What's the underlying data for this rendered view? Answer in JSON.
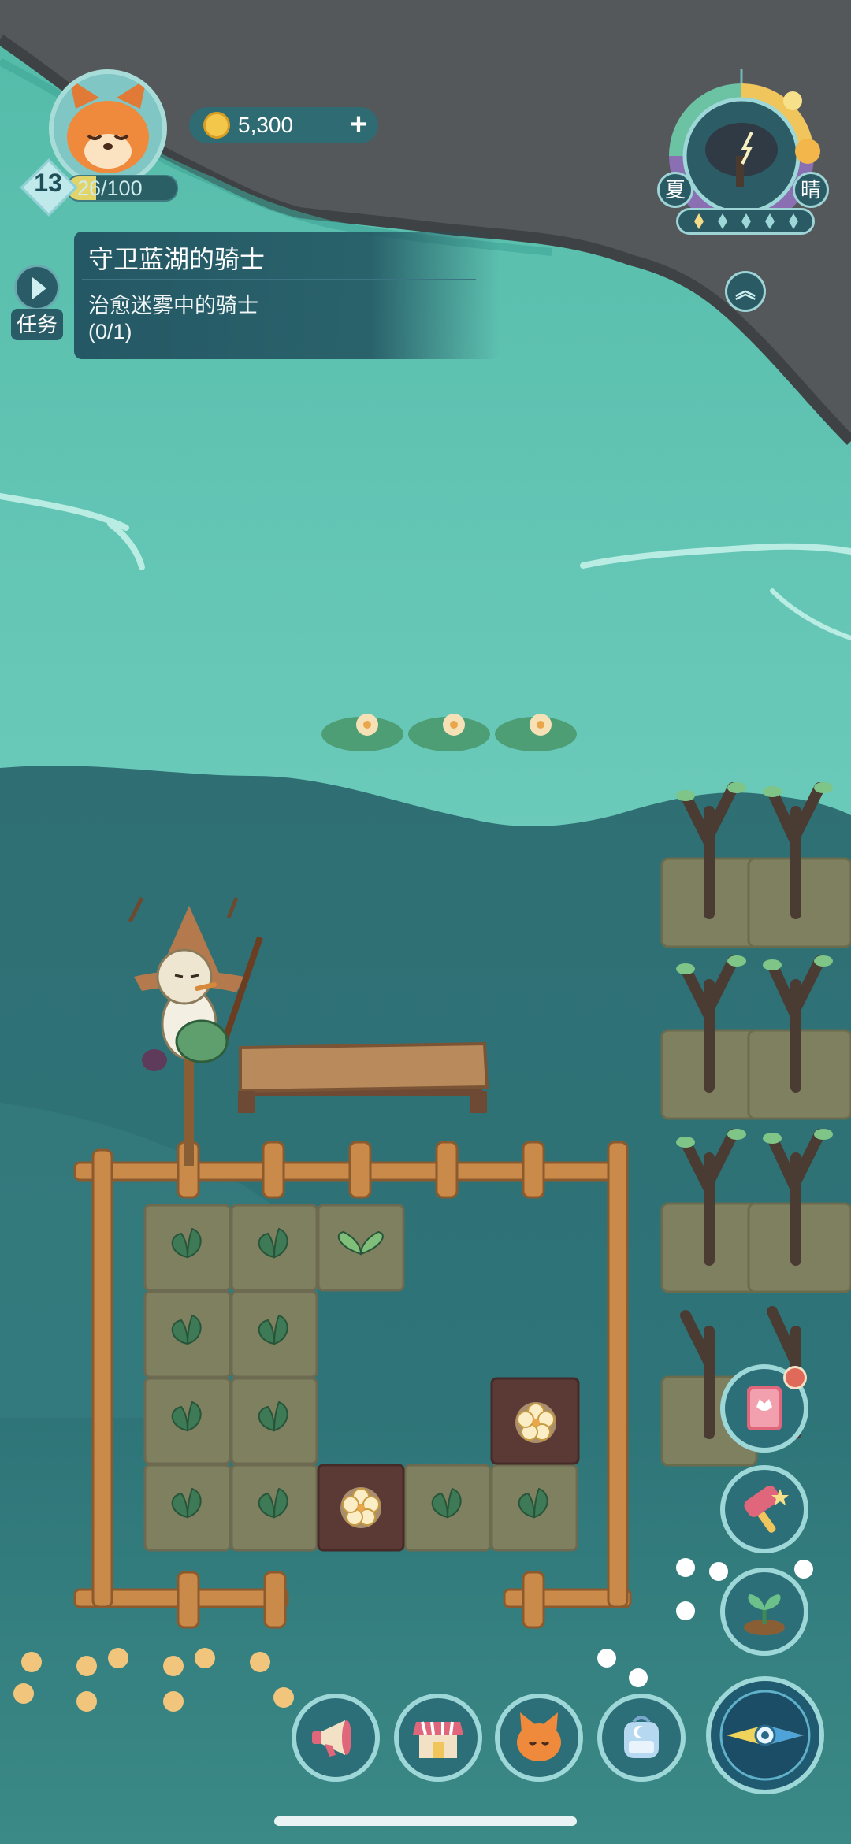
{
  "player": {
    "level": "13",
    "xp_text": "26/100",
    "xp_fraction": 0.26,
    "avatar_icon": "fox-avatar-icon"
  },
  "currency": {
    "coins": "5,300",
    "add_label": "+",
    "coin_icon": "coin-icon"
  },
  "quest": {
    "tab_label": "任务",
    "title": "守卫蓝湖的骑士",
    "description": "治愈迷雾中的骑士",
    "progress": "(0/1)"
  },
  "weather": {
    "season": "夏",
    "condition": "晴",
    "expand_icon": "double-chevron-up-icon",
    "indicator_dots": 5
  },
  "side_buttons": [
    {
      "name": "flower-book-button",
      "icon": "tulip-book-icon",
      "has_notification": true
    },
    {
      "name": "hammer-button",
      "icon": "star-hammer-icon",
      "has_notification": false
    },
    {
      "name": "plant-button",
      "icon": "sprout-icon",
      "has_notification": false
    }
  ],
  "bottom_buttons": [
    {
      "name": "announcement-button",
      "icon": "megaphone-icon"
    },
    {
      "name": "shop-button",
      "icon": "shop-icon"
    },
    {
      "name": "character-button",
      "icon": "fox-icon"
    },
    {
      "name": "backpack-button",
      "icon": "backpack-icon"
    }
  ],
  "compass": {
    "icon": "compass-icon"
  },
  "colors": {
    "lake": "#5fc2b2",
    "dark_water": "#2f7379",
    "rock": "#55585a",
    "soil": "#7f8060",
    "fence": "#c98a4a",
    "hud_panel": "#215260"
  }
}
